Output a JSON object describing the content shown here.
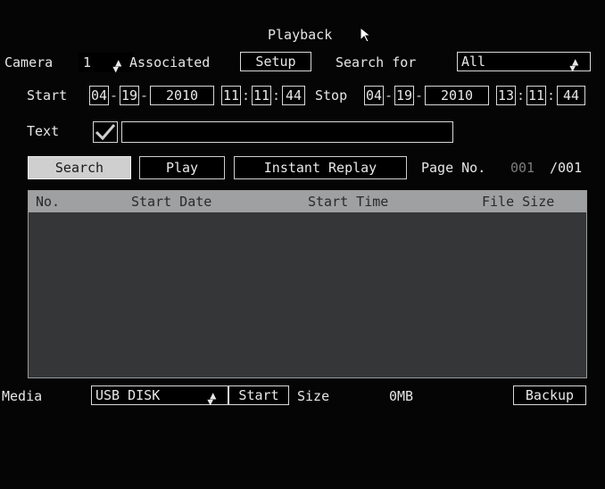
{
  "title": "Playback",
  "camera": {
    "label": "Camera",
    "value": "1"
  },
  "associated": {
    "label": "Associated",
    "setup_label": "Setup"
  },
  "search_for": {
    "label": "Search for",
    "value": "All"
  },
  "start": {
    "label": "Start",
    "month": "04",
    "day": "19",
    "year": "2010",
    "hour": "11",
    "minute": "11",
    "second": "44"
  },
  "stop": {
    "label": "Stop",
    "month": "04",
    "day": "19",
    "year": "2010",
    "hour": "13",
    "minute": "11",
    "second": "44"
  },
  "text_filter": {
    "label": "Text",
    "checked": true,
    "value": ""
  },
  "buttons": {
    "search": "Search",
    "play": "Play",
    "instant_replay": "Instant Replay"
  },
  "page": {
    "label": "Page No.",
    "current": "001",
    "total": "/001"
  },
  "table": {
    "columns": [
      "No.",
      "Start Date",
      "Start Time",
      "File Size"
    ],
    "rows": []
  },
  "media": {
    "label": "Media",
    "device": "USB DISK",
    "start_label": "Start",
    "size_label": "Size",
    "size_value": "0MB",
    "backup_label": "Backup"
  },
  "colors": {
    "background": "#050505",
    "table_body": "#343638",
    "table_header": "#9fa0a2",
    "active_button": "#cfcfcf"
  }
}
